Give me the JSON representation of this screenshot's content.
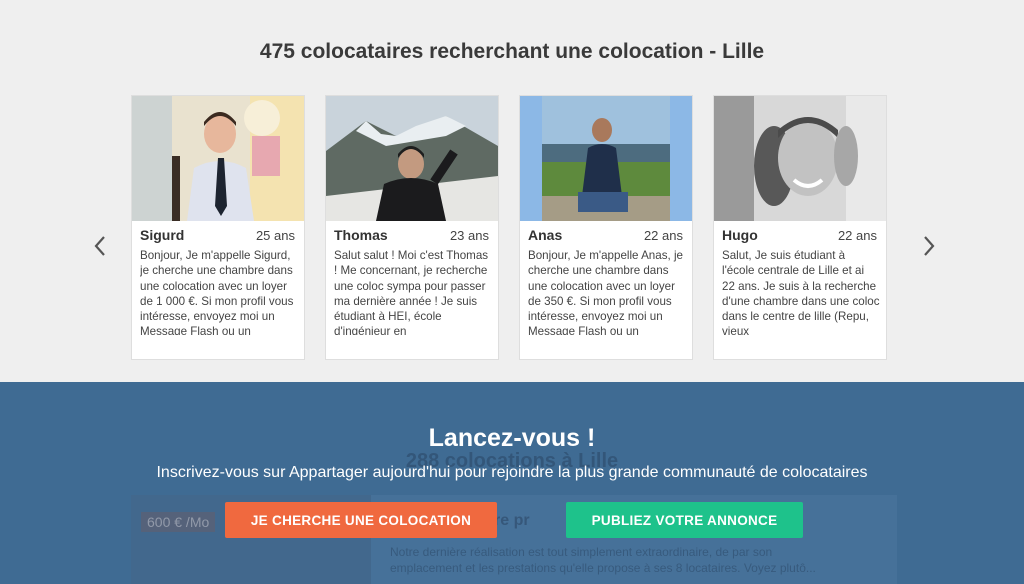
{
  "section_title": "475 colocataires recherchant une colocation - Lille",
  "profiles": [
    {
      "name": "Sigurd",
      "age": "25 ans",
      "description": "Bonjour, Je m'appelle Sigurd, je cherche une chambre dans une colocation avec un loyer de 1 000 €. Si mon profil vous intéresse, envoyez moi un Message Flash ou un"
    },
    {
      "name": "Thomas",
      "age": "23 ans",
      "description": "Salut salut ! Moi c'est Thomas ! Me concernant, je recherche une coloc sympa pour passer ma dernière année ! Je suis étudiant à HEI, école d'ingénieur en"
    },
    {
      "name": "Anas",
      "age": "22 ans",
      "description": "Bonjour, Je m'appelle Anas, je cherche une chambre dans une colocation avec un loyer de 350 €. Si mon profil vous intéresse, envoyez moi un Message Flash ou un"
    },
    {
      "name": "Hugo",
      "age": "22 ans",
      "description": "Salut, Je suis étudiant à l'école centrale de Lille et ai 22 ans. Je suis à la recherche d'une chambre dans une coloc dans le centre de lille (Repu, vieux"
    }
  ],
  "background": {
    "title": "288 colocations à Lille",
    "price": "600 € /Mo",
    "listing_title": "entre pr",
    "listing_text": "Notre dernière réalisation est tout simplement extraordinaire, de par son emplacement et les prestations qu'elle propose à ses 8 locataires. Voyez plutô..."
  },
  "cta": {
    "title": "Lancez-vous !",
    "subtitle": "Inscrivez-vous sur Appartager aujourd'hui pour rejoindre la plus grande communauté de colocataires",
    "btn_search": "JE CHERCHE UNE COLOCATION",
    "btn_publish": "PUBLIEZ VOTRE ANNONCE"
  },
  "colors": {
    "accent_orange": "#f0693f",
    "accent_green": "#1ec28b",
    "banner_blue": "#3f6b93"
  },
  "icons": [
    "chevron-left-icon",
    "chevron-right-icon"
  ]
}
